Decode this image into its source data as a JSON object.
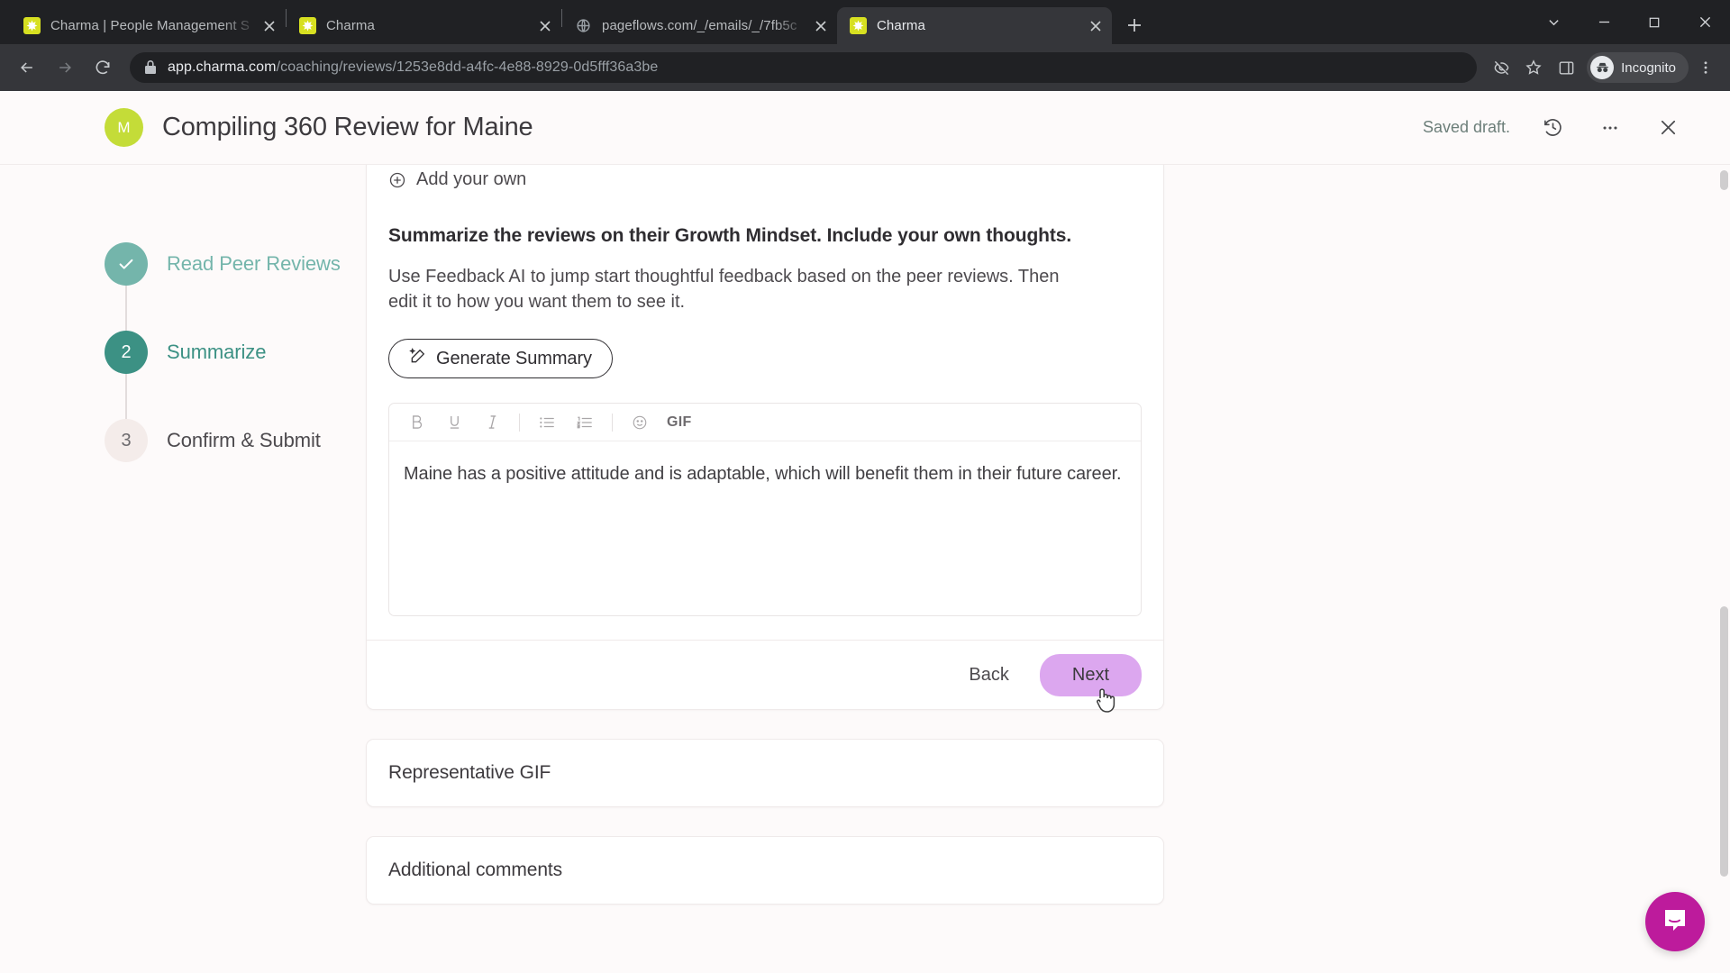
{
  "browser": {
    "tabs": [
      {
        "title": "Charma | People Management S",
        "favicon": "charma-icon",
        "active": false
      },
      {
        "title": "Charma",
        "favicon": "charma-icon",
        "active": false
      },
      {
        "title": "pageflows.com/_/emails/_/7fb5c",
        "favicon": "globe-icon",
        "active": false
      },
      {
        "title": "Charma",
        "favicon": "charma-icon",
        "active": true
      }
    ],
    "new_tab_label": "+",
    "url": {
      "host": "app.charma.com",
      "path": "/coaching/reviews/1253e8dd-a4fc-4e88-8929-0d5fff36a3be"
    },
    "profile_label": "Incognito",
    "icons": {
      "back": "back-arrow-icon",
      "forward": "forward-arrow-icon",
      "reload": "reload-icon",
      "lock": "lock-icon",
      "tracking": "eye-off-icon",
      "bookmark": "star-icon",
      "sidepanel": "side-panel-icon",
      "menu": "kebab-menu-icon",
      "minimize": "minimize-icon",
      "maximize": "maximize-icon",
      "close": "window-close-icon",
      "tab_search": "chevron-down-icon"
    }
  },
  "header": {
    "avatar_initial": "M",
    "avatar_color": "#c4dc38",
    "title": "Compiling 360 Review for Maine",
    "saved_status": "Saved draft.",
    "history_icon": "history-clock-icon",
    "more_icon": "ellipsis-icon",
    "close_icon": "close-icon"
  },
  "stepper": {
    "steps": [
      {
        "marker": "✓",
        "label": "Read Peer Reviews",
        "state": "done"
      },
      {
        "marker": "2",
        "label": "Summarize",
        "state": "current"
      },
      {
        "marker": "3",
        "label": "Confirm & Submit",
        "state": "todo"
      }
    ]
  },
  "main": {
    "add_your_own": "Add your own",
    "question_title": "Summarize the reviews on their Growth Mindset. Include your own thoughts.",
    "question_desc": "Use Feedback AI to jump start thoughtful feedback based on the peer reviews. Then edit it to how you want them to see it.",
    "generate_button": "Generate Summary",
    "generate_icon": "magic-wand-icon",
    "editor": {
      "toolbar": [
        {
          "name": "bold-button",
          "glyph": "B"
        },
        {
          "name": "underline-button",
          "glyph": "U"
        },
        {
          "name": "italic-button",
          "glyph": "I"
        },
        {
          "name": "bullet-list-button",
          "glyph": "list"
        },
        {
          "name": "numbered-list-button",
          "glyph": "numlist"
        },
        {
          "name": "emoji-button",
          "glyph": "smiley"
        },
        {
          "name": "gif-button",
          "glyph": "GIF"
        }
      ],
      "gif_label": "GIF",
      "content": "Maine has a positive attitude and is adaptable, which will benefit them in their future career."
    },
    "back_button": "Back",
    "next_button": "Next",
    "next_button_color": "#dca7ef"
  },
  "sections": [
    {
      "title": "Representative GIF"
    },
    {
      "title": "Additional comments"
    }
  ],
  "intercom": {
    "icon": "chat-bubble-icon",
    "color": "#bd1b9c"
  }
}
